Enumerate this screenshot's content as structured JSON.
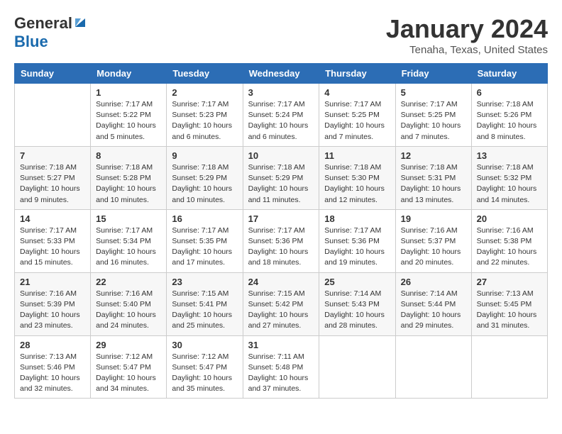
{
  "header": {
    "logo_general": "General",
    "logo_blue": "Blue",
    "month": "January 2024",
    "location": "Tenaha, Texas, United States"
  },
  "weekdays": [
    "Sunday",
    "Monday",
    "Tuesday",
    "Wednesday",
    "Thursday",
    "Friday",
    "Saturday"
  ],
  "weeks": [
    [
      {
        "day": "",
        "info": ""
      },
      {
        "day": "1",
        "info": "Sunrise: 7:17 AM\nSunset: 5:22 PM\nDaylight: 10 hours\nand 5 minutes."
      },
      {
        "day": "2",
        "info": "Sunrise: 7:17 AM\nSunset: 5:23 PM\nDaylight: 10 hours\nand 6 minutes."
      },
      {
        "day": "3",
        "info": "Sunrise: 7:17 AM\nSunset: 5:24 PM\nDaylight: 10 hours\nand 6 minutes."
      },
      {
        "day": "4",
        "info": "Sunrise: 7:17 AM\nSunset: 5:25 PM\nDaylight: 10 hours\nand 7 minutes."
      },
      {
        "day": "5",
        "info": "Sunrise: 7:17 AM\nSunset: 5:25 PM\nDaylight: 10 hours\nand 7 minutes."
      },
      {
        "day": "6",
        "info": "Sunrise: 7:18 AM\nSunset: 5:26 PM\nDaylight: 10 hours\nand 8 minutes."
      }
    ],
    [
      {
        "day": "7",
        "info": "Sunrise: 7:18 AM\nSunset: 5:27 PM\nDaylight: 10 hours\nand 9 minutes."
      },
      {
        "day": "8",
        "info": "Sunrise: 7:18 AM\nSunset: 5:28 PM\nDaylight: 10 hours\nand 10 minutes."
      },
      {
        "day": "9",
        "info": "Sunrise: 7:18 AM\nSunset: 5:29 PM\nDaylight: 10 hours\nand 10 minutes."
      },
      {
        "day": "10",
        "info": "Sunrise: 7:18 AM\nSunset: 5:29 PM\nDaylight: 10 hours\nand 11 minutes."
      },
      {
        "day": "11",
        "info": "Sunrise: 7:18 AM\nSunset: 5:30 PM\nDaylight: 10 hours\nand 12 minutes."
      },
      {
        "day": "12",
        "info": "Sunrise: 7:18 AM\nSunset: 5:31 PM\nDaylight: 10 hours\nand 13 minutes."
      },
      {
        "day": "13",
        "info": "Sunrise: 7:18 AM\nSunset: 5:32 PM\nDaylight: 10 hours\nand 14 minutes."
      }
    ],
    [
      {
        "day": "14",
        "info": "Sunrise: 7:17 AM\nSunset: 5:33 PM\nDaylight: 10 hours\nand 15 minutes."
      },
      {
        "day": "15",
        "info": "Sunrise: 7:17 AM\nSunset: 5:34 PM\nDaylight: 10 hours\nand 16 minutes."
      },
      {
        "day": "16",
        "info": "Sunrise: 7:17 AM\nSunset: 5:35 PM\nDaylight: 10 hours\nand 17 minutes."
      },
      {
        "day": "17",
        "info": "Sunrise: 7:17 AM\nSunset: 5:36 PM\nDaylight: 10 hours\nand 18 minutes."
      },
      {
        "day": "18",
        "info": "Sunrise: 7:17 AM\nSunset: 5:36 PM\nDaylight: 10 hours\nand 19 minutes."
      },
      {
        "day": "19",
        "info": "Sunrise: 7:16 AM\nSunset: 5:37 PM\nDaylight: 10 hours\nand 20 minutes."
      },
      {
        "day": "20",
        "info": "Sunrise: 7:16 AM\nSunset: 5:38 PM\nDaylight: 10 hours\nand 22 minutes."
      }
    ],
    [
      {
        "day": "21",
        "info": "Sunrise: 7:16 AM\nSunset: 5:39 PM\nDaylight: 10 hours\nand 23 minutes."
      },
      {
        "day": "22",
        "info": "Sunrise: 7:16 AM\nSunset: 5:40 PM\nDaylight: 10 hours\nand 24 minutes."
      },
      {
        "day": "23",
        "info": "Sunrise: 7:15 AM\nSunset: 5:41 PM\nDaylight: 10 hours\nand 25 minutes."
      },
      {
        "day": "24",
        "info": "Sunrise: 7:15 AM\nSunset: 5:42 PM\nDaylight: 10 hours\nand 27 minutes."
      },
      {
        "day": "25",
        "info": "Sunrise: 7:14 AM\nSunset: 5:43 PM\nDaylight: 10 hours\nand 28 minutes."
      },
      {
        "day": "26",
        "info": "Sunrise: 7:14 AM\nSunset: 5:44 PM\nDaylight: 10 hours\nand 29 minutes."
      },
      {
        "day": "27",
        "info": "Sunrise: 7:13 AM\nSunset: 5:45 PM\nDaylight: 10 hours\nand 31 minutes."
      }
    ],
    [
      {
        "day": "28",
        "info": "Sunrise: 7:13 AM\nSunset: 5:46 PM\nDaylight: 10 hours\nand 32 minutes."
      },
      {
        "day": "29",
        "info": "Sunrise: 7:12 AM\nSunset: 5:47 PM\nDaylight: 10 hours\nand 34 minutes."
      },
      {
        "day": "30",
        "info": "Sunrise: 7:12 AM\nSunset: 5:47 PM\nDaylight: 10 hours\nand 35 minutes."
      },
      {
        "day": "31",
        "info": "Sunrise: 7:11 AM\nSunset: 5:48 PM\nDaylight: 10 hours\nand 37 minutes."
      },
      {
        "day": "",
        "info": ""
      },
      {
        "day": "",
        "info": ""
      },
      {
        "day": "",
        "info": ""
      }
    ]
  ]
}
